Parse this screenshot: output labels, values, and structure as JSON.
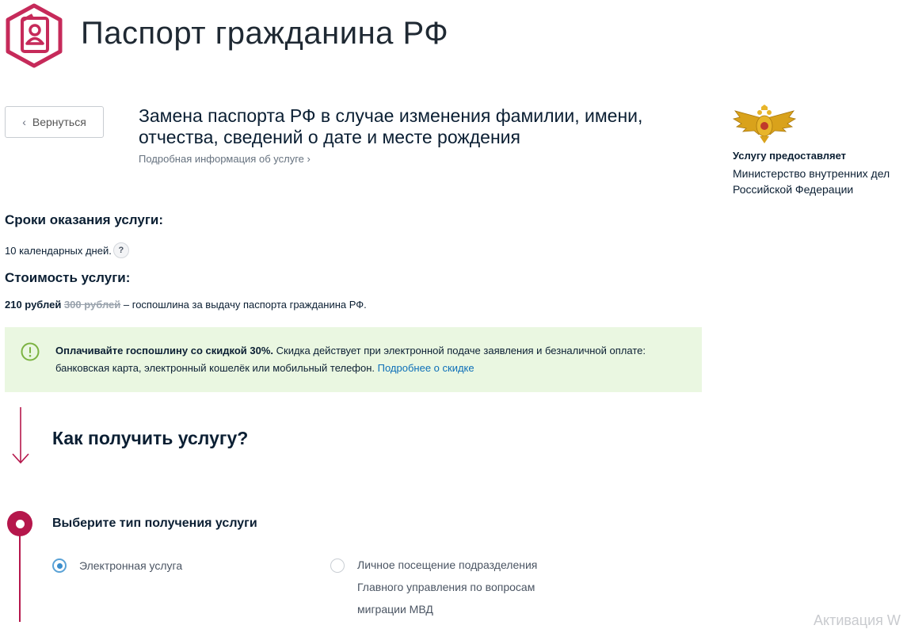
{
  "header": {
    "title": "Паспорт гражданина РФ",
    "logo_icon": "passport-icon",
    "brand_color": "#b5164b"
  },
  "nav": {
    "back_label": "Вернуться",
    "back_icon": "chevron-left-icon"
  },
  "service": {
    "title": "Замена паспорта РФ в случае изменения фамилии, имени, отчества, сведений о дате и месте рождения",
    "info_link": "Подробная информация об услуге ›"
  },
  "provider": {
    "label": "Услугу предоставляет",
    "name": "Министерство внутренних дел Российской Федерации",
    "emblem_icon": "double-headed-eagle-emblem"
  },
  "terms": {
    "heading": "Сроки оказания услуги:",
    "value": "10 календарных дней.",
    "help_label": "?"
  },
  "cost": {
    "heading": "Стоимость услуги:",
    "new_price": "210 рублей",
    "old_price": "300 рублей",
    "description": " – госпошлина за выдачу паспорта гражданина РФ."
  },
  "discount": {
    "bold": "Оплачивайте госпошлину со скидкой 30%.",
    "text": " Скидка действует при электронной подаче заявления и безналичной оплате: банковская карта, электронный кошелёк или мобильный телефон. ",
    "link": "Подробнее о скидке",
    "icon": "exclamation-circle-icon",
    "bg_color": "#eaf7e1"
  },
  "how": {
    "heading": "Как получить услугу?",
    "arrow_icon": "arrow-down-icon"
  },
  "step": {
    "heading": "Выберите тип получения услуги",
    "options": [
      {
        "label": "Электронная услуга",
        "selected": true
      },
      {
        "label": "Личное посещение подразделения Главного управления по вопросам миграции МВД",
        "selected": false
      }
    ]
  },
  "watermark": "Активация W"
}
